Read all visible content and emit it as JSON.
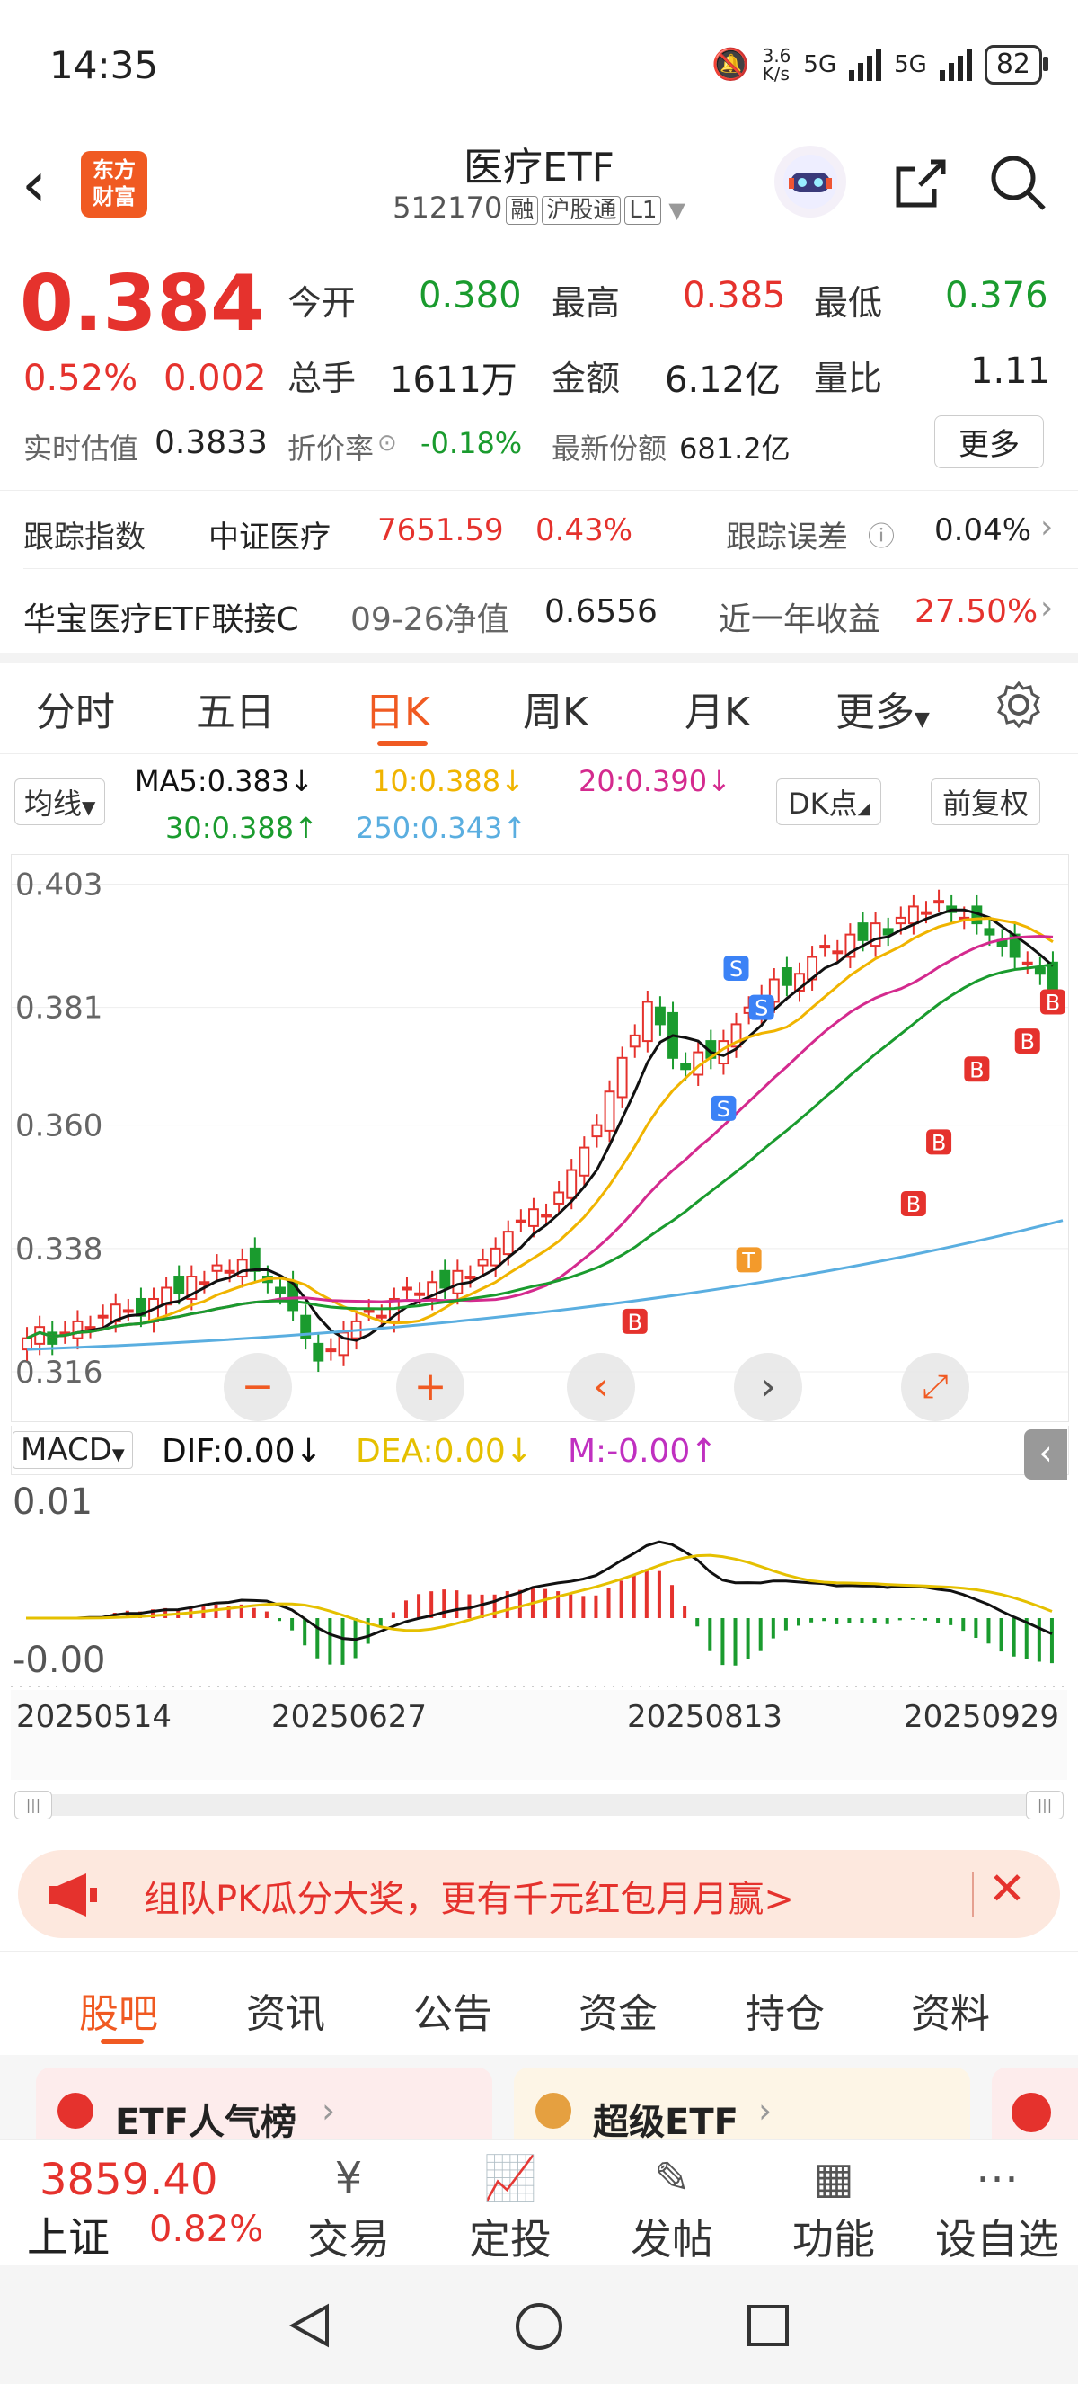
{
  "status": {
    "time": "14:35",
    "speed": "3.6\nK/s",
    "net1": "5G",
    "net2": "5G",
    "battery": "82"
  },
  "header": {
    "logo_text": "东方\n财富",
    "title": "医疗ETF",
    "code": "512170",
    "tags": [
      "融",
      "沪股通",
      "L1"
    ]
  },
  "quote": {
    "price": "0.384",
    "change_pct": "0.52%",
    "change": "0.002",
    "open_label": "今开",
    "open": "0.380",
    "high_label": "最高",
    "high": "0.385",
    "low_label": "最低",
    "low": "0.376",
    "vol_label": "总手",
    "vol": "1611万",
    "amt_label": "金额",
    "amt": "6.12亿",
    "ratio_label": "量比",
    "ratio": "1.11",
    "iopv_label": "实时估值",
    "iopv": "0.3833",
    "prem_label": "折价率",
    "prem": "-0.18%",
    "share_label": "最新份额",
    "share": "681.2亿",
    "more": "更多"
  },
  "track": {
    "label": "跟踪指数",
    "index": "中证医疗",
    "value": "7651.59",
    "pct": "0.43%",
    "err_label": "跟踪误差",
    "err": "0.04%"
  },
  "link": {
    "name": "华宝医疗ETF联接C",
    "nav_label": "09-26净值",
    "nav": "0.6556",
    "ret_label": "近一年收益",
    "ret": "27.50%"
  },
  "tabs": [
    "分时",
    "五日",
    "日K",
    "周K",
    "月K",
    "更多"
  ],
  "active_tab": "日K",
  "ma": {
    "selector": "均线",
    "ma5": "MA5:0.383",
    "ma10": "10:0.388",
    "ma20": "20:0.390",
    "ma30": "30:0.388",
    "ma250": "250:0.343",
    "dk": "DK点",
    "adj": "前复权"
  },
  "ma_arrows": {
    "ma5": "↓",
    "ma10": "↓",
    "ma20": "↓",
    "ma30": "↑",
    "ma250": "↑"
  },
  "colors": {
    "up": "#e5322d",
    "down": "#1a9b2e",
    "ma5": "#111111",
    "ma10": "#f0b400",
    "ma20": "#d42a8e",
    "ma30": "#1a9b2e",
    "ma250": "#5aaee0",
    "dea": "#e5c000",
    "accent": "#f05a22"
  },
  "chart_data": {
    "type": "candlestick",
    "ylabels": [
      "0.403",
      "0.381",
      "0.360",
      "0.338",
      "0.316"
    ],
    "dates": [
      "20250514",
      "20250627",
      "20250813",
      "20250929"
    ],
    "close": [
      0.322,
      0.324,
      0.321,
      0.323,
      0.325,
      0.324,
      0.326,
      0.328,
      0.327,
      0.326,
      0.329,
      0.331,
      0.33,
      0.333,
      0.332,
      0.335,
      0.334,
      0.336,
      0.334,
      0.332,
      0.33,
      0.327,
      0.322,
      0.318,
      0.32,
      0.323,
      0.325,
      0.327,
      0.326,
      0.329,
      0.331,
      0.33,
      0.332,
      0.331,
      0.334,
      0.333,
      0.336,
      0.338,
      0.341,
      0.343,
      0.345,
      0.344,
      0.348,
      0.352,
      0.356,
      0.36,
      0.366,
      0.372,
      0.376,
      0.382,
      0.378,
      0.372,
      0.37,
      0.373,
      0.372,
      0.375,
      0.378,
      0.381,
      0.383,
      0.386,
      0.385,
      0.387,
      0.39,
      0.392,
      0.391,
      0.394,
      0.393,
      0.396,
      0.394,
      0.397,
      0.399,
      0.398,
      0.4,
      0.398,
      0.397,
      0.396,
      0.394,
      0.392,
      0.39,
      0.389,
      0.387,
      0.384
    ],
    "ma250": [
      0.32,
      0.343
    ],
    "macd_dif": [
      -0.002,
      0.01,
      -0.001
    ],
    "macd_labels": [
      "0.01",
      "-0.00"
    ],
    "markers": [
      "S",
      "S",
      "S",
      "B",
      "T"
    ]
  },
  "macd": {
    "name": "MACD",
    "dif": "DIF:0.00",
    "dea": "DEA:0.00",
    "m": "M:-0.00",
    "dif_arrow": "↓",
    "dea_arrow": "↓",
    "m_arrow": "↑"
  },
  "banner": {
    "text": "组队PK瓜分大奖，更有千元红包月月赢>"
  },
  "section_tabs": [
    "股吧",
    "资讯",
    "公告",
    "资金",
    "持仓",
    "资料"
  ],
  "cards": [
    {
      "title": "ETF人气榜"
    },
    {
      "title": "超级ETF"
    }
  ],
  "bottom": {
    "index_value": "3859.40",
    "index_name": "上证",
    "index_pct": "0.82%",
    "items": [
      "交易",
      "定投",
      "发帖",
      "功能",
      "设自选"
    ]
  }
}
